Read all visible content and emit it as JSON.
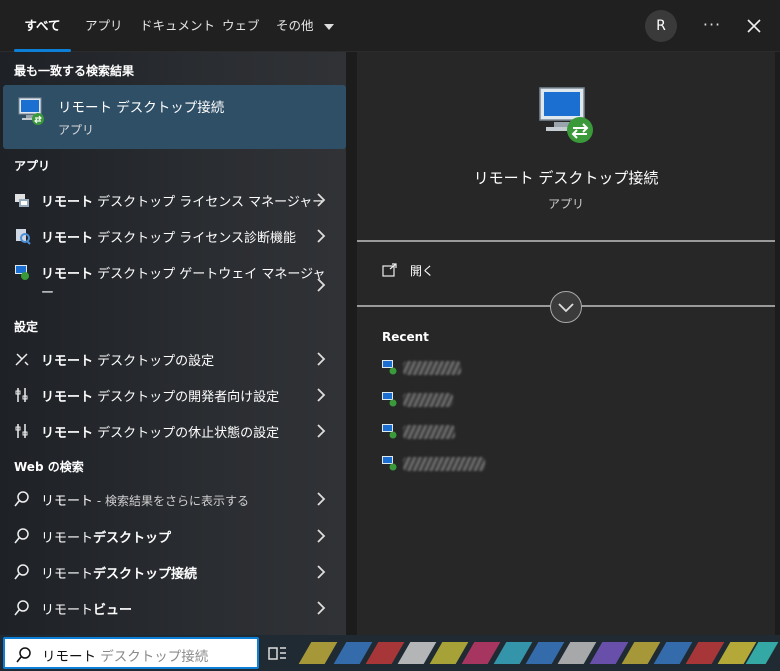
{
  "tabs": [
    {
      "label": "すべて"
    },
    {
      "label": "アプリ"
    },
    {
      "label": "ドキュメント"
    },
    {
      "label": "ウェブ"
    },
    {
      "label": "その他"
    }
  ],
  "avatar_letter": "R",
  "more_label": "···",
  "sections": {
    "best": "最も一致する検索結果",
    "apps": "アプリ",
    "settings": "設定",
    "web": "Web の検索"
  },
  "best": {
    "title": "リモート デスクトップ接続",
    "subtitle": "アプリ"
  },
  "apps": [
    {
      "bold": "リモート",
      "rest": " デスクトップ ライセンス マネージャー",
      "icon": "license-manager-icon"
    },
    {
      "bold": "リモート",
      "rest": " デスクトップ ライセンス診断機能",
      "icon": "license-diagnoser-icon"
    },
    {
      "bold": "リモート",
      "rest": " デスクトップ ゲートウェイ マネージャ",
      "rest2": "ー",
      "icon": "gateway-manager-icon"
    }
  ],
  "settings": [
    {
      "bold": "リモート",
      "rest": " デスクトップの設定",
      "icon": "remote-desktop-settings-icon"
    },
    {
      "bold": "リモート",
      "rest": " デスクトップの開発者向け設定",
      "icon": "developer-settings-icon"
    },
    {
      "bold": "リモート",
      "rest": " デスクトップの休止状態の設定",
      "icon": "sleep-settings-icon"
    }
  ],
  "web": [
    {
      "plain": "リモート",
      "bold": "",
      "extra": " - 検索結果をさらに表示する"
    },
    {
      "plain": "リモート",
      "bold": "デスクトップ",
      "extra": ""
    },
    {
      "plain": "リモート",
      "bold": "デスクトップ接続",
      "extra": ""
    },
    {
      "plain": "リモート",
      "bold": "ビュー",
      "extra": ""
    }
  ],
  "detail": {
    "title": "リモート デスクトップ接続",
    "subtitle": "アプリ",
    "open_label": "開く",
    "recent_label": "Recent"
  },
  "search": {
    "typed": "リモート",
    "suggestion": " デスクトップ接続"
  },
  "colors": {
    "accent": "#0e7fd6",
    "best_match_bg": "#2f4f67"
  }
}
